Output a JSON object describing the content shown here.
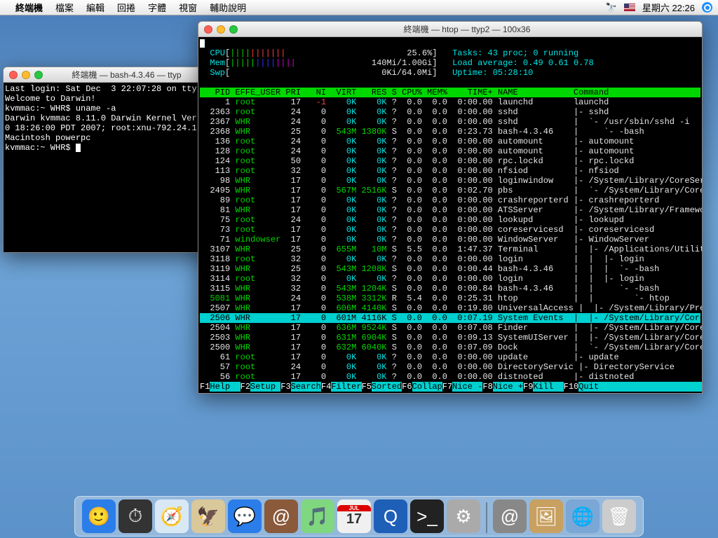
{
  "menubar": {
    "app": "終端機",
    "items": [
      "檔案",
      "編輯",
      "回捲",
      "字體",
      "視窗",
      "輔助說明"
    ],
    "clock": "星期六 22:26"
  },
  "bash_window": {
    "title": "終端機 — bash-4.3.46 — ttyp",
    "lines": [
      "Last login: Sat Dec  3 22:07:28 on tty",
      "Welcome to Darwin!",
      "kvmmac:~ WHR$ uname -a",
      "Darwin kvmmac 8.11.0 Darwin Kernel Ver",
      "0 18:26:00 PDT 2007; root:xnu-792.24.1",
      "Macintosh powerpc",
      "kvmmac:~ WHR$ "
    ]
  },
  "htop_window": {
    "title": "終端機 — htop — ttyp2 — 100x36",
    "meters": {
      "cpu_label": "CPU",
      "cpu_bar": "[|||||||||||                        25.6%]",
      "mem_label": "Mem",
      "mem_bar": "[|||||||||||||               140Mi/1.00Gi]",
      "swp_label": "Swp",
      "swp_bar": "[                              0Ki/64.0Mi]",
      "tasks": "Tasks: 43 proc; 0 running",
      "load": "Load average: 0.49 0.61 0.78",
      "uptime": "Uptime: 05:28:10"
    },
    "header": "   PID EFFE_USER PRI   NI  VIRT   RES S CPU% MEM%    TIME+ NAME           Command",
    "rows": [
      {
        "pid": "1",
        "user": "root",
        "pri": "17",
        "ni": "-1",
        "virt": "0K",
        "res": "0K",
        "s": "?",
        "cpu": "0.0",
        "mem": "0.0",
        "time": "0:00.00",
        "name": "launchd",
        "cmd": "launchd",
        "sel": false,
        "ni_red": true
      },
      {
        "pid": "2363",
        "user": "root",
        "pri": "24",
        "ni": "0",
        "virt": "0K",
        "res": "0K",
        "s": "?",
        "cpu": "0.0",
        "mem": "0.0",
        "time": "0:00.00",
        "name": "sshd",
        "cmd": "|- sshd",
        "sel": false
      },
      {
        "pid": "2367",
        "user": "WHR",
        "pri": "24",
        "ni": "0",
        "virt": "0K",
        "res": "0K",
        "s": "?",
        "cpu": "0.0",
        "mem": "0.0",
        "time": "0:00.00",
        "name": "sshd",
        "cmd": "|  `- /usr/sbin/sshd -i",
        "sel": false
      },
      {
        "pid": "2368",
        "user": "WHR",
        "pri": "25",
        "ni": "0",
        "virt": "543M",
        "res": "1380K",
        "s": "S",
        "cpu": "0.0",
        "mem": "0.0",
        "time": "0:23.73",
        "name": "bash-4.3.46",
        "cmd": "|     `- -bash",
        "sel": false
      },
      {
        "pid": "136",
        "user": "root",
        "pri": "24",
        "ni": "0",
        "virt": "0K",
        "res": "0K",
        "s": "?",
        "cpu": "0.0",
        "mem": "0.0",
        "time": "0:00.00",
        "name": "automount",
        "cmd": "|- automount",
        "sel": false
      },
      {
        "pid": "128",
        "user": "root",
        "pri": "24",
        "ni": "0",
        "virt": "0K",
        "res": "0K",
        "s": "?",
        "cpu": "0.0",
        "mem": "0.0",
        "time": "0:00.00",
        "name": "automount",
        "cmd": "|- automount",
        "sel": false
      },
      {
        "pid": "124",
        "user": "root",
        "pri": "50",
        "ni": "0",
        "virt": "0K",
        "res": "0K",
        "s": "?",
        "cpu": "0.0",
        "mem": "0.0",
        "time": "0:00.00",
        "name": "rpc.lockd",
        "cmd": "|- rpc.lockd",
        "sel": false
      },
      {
        "pid": "113",
        "user": "root",
        "pri": "32",
        "ni": "0",
        "virt": "0K",
        "res": "0K",
        "s": "?",
        "cpu": "0.0",
        "mem": "0.0",
        "time": "0:00.00",
        "name": "nfsiod",
        "cmd": "|- nfsiod",
        "sel": false
      },
      {
        "pid": "98",
        "user": "WHR",
        "pri": "17",
        "ni": "0",
        "virt": "0K",
        "res": "0K",
        "s": "?",
        "cpu": "0.0",
        "mem": "0.0",
        "time": "0:00.00",
        "name": "loginwindow",
        "cmd": "|- /System/Library/CoreServ",
        "sel": false
      },
      {
        "pid": "2495",
        "user": "WHR",
        "pri": "17",
        "ni": "0",
        "virt": "567M",
        "res": "2516K",
        "s": "S",
        "cpu": "0.0",
        "mem": "0.0",
        "time": "0:02.70",
        "name": "pbs",
        "cmd": "|  `- /System/Library/CoreS",
        "sel": false
      },
      {
        "pid": "89",
        "user": "root",
        "pri": "17",
        "ni": "0",
        "virt": "0K",
        "res": "0K",
        "s": "?",
        "cpu": "0.0",
        "mem": "0.0",
        "time": "0:00.00",
        "name": "crashreporterd",
        "cmd": "|- crashreporterd",
        "sel": false
      },
      {
        "pid": "81",
        "user": "WHR",
        "pri": "17",
        "ni": "0",
        "virt": "0K",
        "res": "0K",
        "s": "?",
        "cpu": "0.0",
        "mem": "0.0",
        "time": "0:00.00",
        "name": "ATSServer",
        "cmd": "|- /System/Library/Framewor",
        "sel": false
      },
      {
        "pid": "75",
        "user": "root",
        "pri": "24",
        "ni": "0",
        "virt": "0K",
        "res": "0K",
        "s": "?",
        "cpu": "0.0",
        "mem": "0.0",
        "time": "0:00.00",
        "name": "lookupd",
        "cmd": "|- lookupd",
        "sel": false
      },
      {
        "pid": "73",
        "user": "root",
        "pri": "17",
        "ni": "0",
        "virt": "0K",
        "res": "0K",
        "s": "?",
        "cpu": "0.0",
        "mem": "0.0",
        "time": "0:00.00",
        "name": "coreservicesd",
        "cmd": "|- coreservicesd",
        "sel": false
      },
      {
        "pid": "71",
        "user": "windowser",
        "pri": "17",
        "ni": "0",
        "virt": "0K",
        "res": "0K",
        "s": "?",
        "cpu": "0.0",
        "mem": "0.0",
        "time": "0:00.00",
        "name": "WindowServer",
        "cmd": "|- WindowServer",
        "sel": false
      },
      {
        "pid": "3107",
        "user": "WHR",
        "pri": "25",
        "ni": "0",
        "virt": "655M",
        "res": "10M",
        "s": "S",
        "cpu": "5.5",
        "mem": "0.0",
        "time": "1:47.37",
        "name": "Terminal",
        "cmd": "|  |- /Applications/Utiliti",
        "sel": false
      },
      {
        "pid": "3118",
        "user": "root",
        "pri": "32",
        "ni": "0",
        "virt": "0K",
        "res": "0K",
        "s": "?",
        "cpu": "0.0",
        "mem": "0.0",
        "time": "0:00.00",
        "name": "login",
        "cmd": "|  |  |- login",
        "sel": false
      },
      {
        "pid": "3119",
        "user": "WHR",
        "pri": "25",
        "ni": "0",
        "virt": "543M",
        "res": "1208K",
        "s": "S",
        "cpu": "0.0",
        "mem": "0.0",
        "time": "0:00.44",
        "name": "bash-4.3.46",
        "cmd": "|  |  |  `- -bash",
        "sel": false
      },
      {
        "pid": "3114",
        "user": "root",
        "pri": "32",
        "ni": "0",
        "virt": "0K",
        "res": "0K",
        "s": "?",
        "cpu": "0.0",
        "mem": "0.0",
        "time": "0:00.00",
        "name": "login",
        "cmd": "|  |  |- login",
        "sel": false
      },
      {
        "pid": "3115",
        "user": "WHR",
        "pri": "32",
        "ni": "0",
        "virt": "543M",
        "res": "1204K",
        "s": "S",
        "cpu": "0.0",
        "mem": "0.0",
        "time": "0:00.84",
        "name": "bash-4.3.46",
        "cmd": "|  |     `- -bash",
        "sel": false
      },
      {
        "pid": "5081",
        "user": "WHR",
        "pri": "24",
        "ni": "0",
        "virt": "538M",
        "res": "3312K",
        "s": "R",
        "cpu": "5.4",
        "mem": "0.0",
        "time": "0:25.31",
        "name": "htop",
        "cmd": "|  |        `- htop",
        "sel": false,
        "pid_green": true
      },
      {
        "pid": "2507",
        "user": "WHR",
        "pri": "17",
        "ni": "0",
        "virt": "606M",
        "res": "4140K",
        "s": "S",
        "cpu": "0.0",
        "mem": "0.0",
        "time": "0:19.80",
        "name": "UniversalAccess",
        "cmd": "|  |- /System/Library/Prefe",
        "sel": false
      },
      {
        "pid": "2506",
        "user": "WHR",
        "pri": "17",
        "ni": "0",
        "virt": "601M",
        "res": "4116K",
        "s": "S",
        "cpu": "0.0",
        "mem": "0.0",
        "time": "0:07.19",
        "name": "System Events",
        "cmd": "|  |- /System/Library/CoreS",
        "sel": true
      },
      {
        "pid": "2504",
        "user": "WHR",
        "pri": "17",
        "ni": "0",
        "virt": "636M",
        "res": "9524K",
        "s": "S",
        "cpu": "0.0",
        "mem": "0.0",
        "time": "0:07.08",
        "name": "Finder",
        "cmd": "|  |- /System/Library/CoreS",
        "sel": false
      },
      {
        "pid": "2503",
        "user": "WHR",
        "pri": "17",
        "ni": "0",
        "virt": "631M",
        "res": "6904K",
        "s": "S",
        "cpu": "0.0",
        "mem": "0.0",
        "time": "0:09.13",
        "name": "SystemUIServer",
        "cmd": "|  |- /System/Library/CoreS",
        "sel": false
      },
      {
        "pid": "2500",
        "user": "WHR",
        "pri": "17",
        "ni": "0",
        "virt": "632M",
        "res": "6040K",
        "s": "S",
        "cpu": "0.0",
        "mem": "0.0",
        "time": "0:07.09",
        "name": "Dock",
        "cmd": "|  `- /System/Library/CoreS",
        "sel": false
      },
      {
        "pid": "61",
        "user": "root",
        "pri": "17",
        "ni": "0",
        "virt": "0K",
        "res": "0K",
        "s": "?",
        "cpu": "0.0",
        "mem": "0.0",
        "time": "0:00.00",
        "name": "update",
        "cmd": "|- update",
        "sel": false
      },
      {
        "pid": "57",
        "user": "root",
        "pri": "24",
        "ni": "0",
        "virt": "0K",
        "res": "0K",
        "s": "?",
        "cpu": "0.0",
        "mem": "0.0",
        "time": "0:00.00",
        "name": "DirectoryServic",
        "cmd": "|- DirectoryService",
        "sel": false
      },
      {
        "pid": "56",
        "user": "root",
        "pri": "17",
        "ni": "0",
        "virt": "0K",
        "res": "0K",
        "s": "?",
        "cpu": "0.0",
        "mem": "0.0",
        "time": "0:00.00",
        "name": "distnoted",
        "cmd": "|- distnoted",
        "sel": false
      }
    ],
    "footer": [
      {
        "k": "F1",
        "l": "Help  "
      },
      {
        "k": "F2",
        "l": "Setup "
      },
      {
        "k": "F3",
        "l": "Search"
      },
      {
        "k": "F4",
        "l": "Filter"
      },
      {
        "k": "F5",
        "l": "Sorted"
      },
      {
        "k": "F6",
        "l": "Collap"
      },
      {
        "k": "F7",
        "l": "Nice -"
      },
      {
        "k": "F8",
        "l": "Nice +"
      },
      {
        "k": "F9",
        "l": "Kill  "
      },
      {
        "k": "F10",
        "l": "Quit  "
      }
    ]
  },
  "dock_icons": [
    "finder",
    "dashboard",
    "safari",
    "mail",
    "ichat",
    "address",
    "itunes",
    "ical",
    "quicktime",
    "terminal",
    "sysprefs",
    "divider",
    "mail2",
    "pictures",
    "site",
    "trash"
  ]
}
